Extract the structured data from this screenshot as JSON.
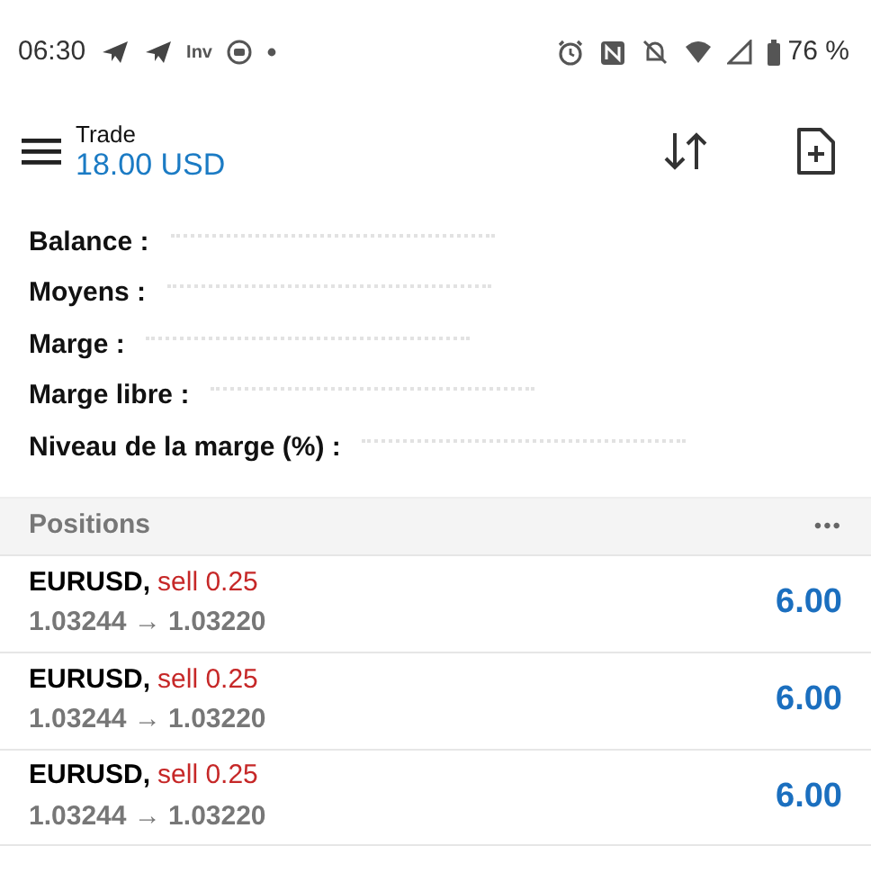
{
  "status_bar": {
    "time": "06:30",
    "notification_text": "Inv",
    "battery": "76 %"
  },
  "header": {
    "title": "Trade",
    "balance": "18.00 USD"
  },
  "summary": [
    {
      "label": "Balance :"
    },
    {
      "label": "Moyens :"
    },
    {
      "label": "Marge :"
    },
    {
      "label": "Marge libre :"
    },
    {
      "label": "Niveau de la marge (%) :"
    }
  ],
  "positions": {
    "title": "Positions",
    "menu": "•••",
    "rows": [
      {
        "symbol": "EURUSD,",
        "order": "sell 0.25",
        "prices": "1.03244 → 1.03220",
        "profit": "6.00"
      },
      {
        "symbol": "EURUSD,",
        "order": "sell 0.25",
        "prices": "1.03244 → 1.03220",
        "profit": "6.00"
      },
      {
        "symbol": "EURUSD,",
        "order": "sell 0.25",
        "prices": "1.03244 → 1.03220",
        "profit": "6.00"
      }
    ]
  }
}
